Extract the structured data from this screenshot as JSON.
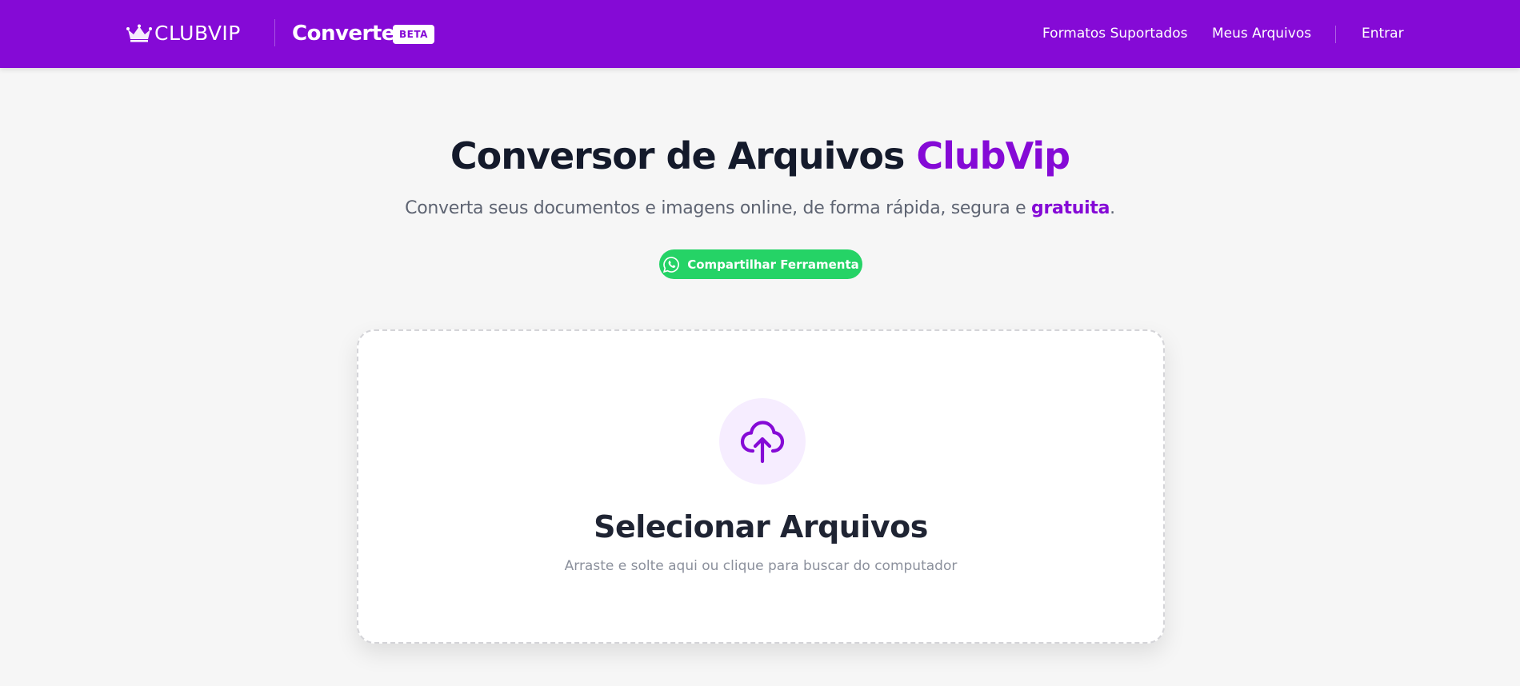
{
  "header": {
    "brand": "CLUBVIP",
    "app_title": "Converter",
    "badge": "BETA",
    "nav": {
      "formats": "Formatos Suportados",
      "files": "Meus Arquivos",
      "login": "Entrar"
    }
  },
  "hero": {
    "title_main": "Conversor de Arquivos ",
    "title_accent": "ClubVip",
    "subtitle_main": "Converta seus documentos e imagens online, de forma rápida, segura e ",
    "subtitle_accent": "gratuita",
    "subtitle_end": ".",
    "share_button": "Compartilhar Ferramenta"
  },
  "upload": {
    "title": "Selecionar Arquivos",
    "hint": "Arraste e solte aqui ou clique para buscar do computador"
  },
  "colors": {
    "brand_purple": "#850ad6",
    "whatsapp_green": "#25d366",
    "background": "#f6f6f6"
  },
  "icons": {
    "logo": "crown-icon",
    "share": "whatsapp-icon",
    "upload": "cloud-upload-icon"
  }
}
